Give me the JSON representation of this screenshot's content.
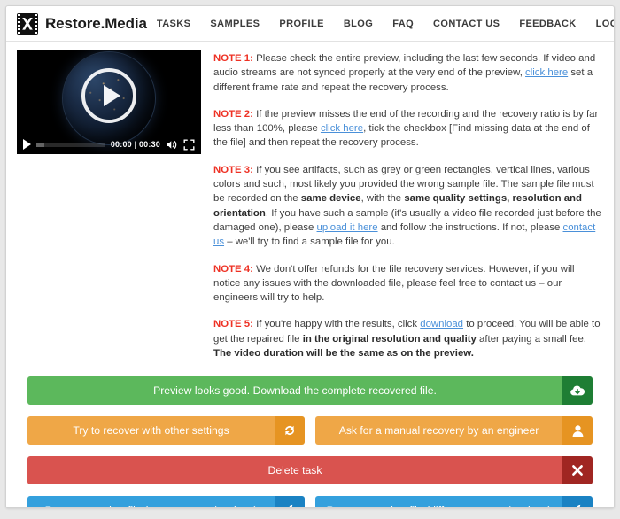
{
  "header": {
    "brand_name": "Restore.Media",
    "logo_icon": "film-strip-x-icon",
    "nav": [
      {
        "label": "TASKS",
        "name": "nav-tasks"
      },
      {
        "label": "SAMPLES",
        "name": "nav-samples"
      },
      {
        "label": "PROFILE",
        "name": "nav-profile"
      },
      {
        "label": "BLOG",
        "name": "nav-blog"
      },
      {
        "label": "FAQ",
        "name": "nav-faq"
      },
      {
        "label": "CONTACT US",
        "name": "nav-contact-us"
      },
      {
        "label": "FEEDBACK",
        "name": "nav-feedback"
      },
      {
        "label": "LOGOUT",
        "name": "nav-logout"
      }
    ]
  },
  "video": {
    "current_time": "00:00",
    "duration": "00:30",
    "time_display": "00:00 | 00:30",
    "play_icon": "play-icon",
    "volume_icon": "volume-icon",
    "fullscreen_icon": "fullscreen-icon",
    "poster_description": "earth-from-space-night"
  },
  "notes": {
    "note1": {
      "label": "NOTE 1:",
      "part1": " Please check the entire preview, including the last few seconds. If video and audio streams are not synced properly at the very end of the preview, ",
      "link1": "click here",
      "part2": " set a different frame rate and repeat the recovery process."
    },
    "note2": {
      "label": "NOTE 2:",
      "part1": " If the preview misses the end of the recording and the recovery ratio is by far less than 100%, please ",
      "link1": "click here",
      "part2": ", tick the checkbox [Find missing data at the end of the file] and then repeat the recovery process."
    },
    "note3": {
      "label": "NOTE 3:",
      "part1": " If you see artifacts, such as grey or green rectangles, vertical lines, various colors and such, most likely you provided the wrong sample file. The sample file must be recorded on the ",
      "bold1": "same device",
      "part2": ", with the ",
      "bold2": "same quality settings, resolution and orientation",
      "part3": ". If you have such a sample (it's usually a video file recorded just before the damaged one), please ",
      "link1": "upload it here",
      "part4": " and follow the instructions. If not, please ",
      "link2": "contact us",
      "part5": " – we'll try to find a sample file for you."
    },
    "note4": {
      "label": "NOTE 4:",
      "part1": " We don't offer refunds for the file recovery services. However, if you will notice any issues with the downloaded file, please feel free to contact us – our engineers will try to help."
    },
    "note5": {
      "label": "NOTE 5:",
      "part1": " If you're happy with the results, click ",
      "link1": "download",
      "part2": " to proceed. You will be able to get the repaired file ",
      "bold1": "in the original resolution and quality",
      "part3": " after paying a small fee. ",
      "bold2": "The video duration will be the same as on the preview."
    }
  },
  "actions": {
    "download": {
      "label": "Preview looks good. Download the complete recovered file.",
      "icon": "cloud-download-icon",
      "color": "#5cb85c"
    },
    "retry": {
      "label": "Try to recover with other settings",
      "icon": "refresh-icon",
      "color": "#efa747"
    },
    "manual": {
      "label": "Ask for a manual recovery by an engineer",
      "icon": "user-icon",
      "color": "#efa747"
    },
    "delete": {
      "label": "Delete task",
      "icon": "close-x-icon",
      "color": "#d9534f"
    },
    "recover_same": {
      "label": "Recover another file (same camera/settings)",
      "icon": "wrench-icon",
      "color": "#34a0dd"
    },
    "recover_different": {
      "label": "Recover another file (different camera/settings)",
      "icon": "wrench-icon",
      "color": "#34a0dd"
    }
  }
}
